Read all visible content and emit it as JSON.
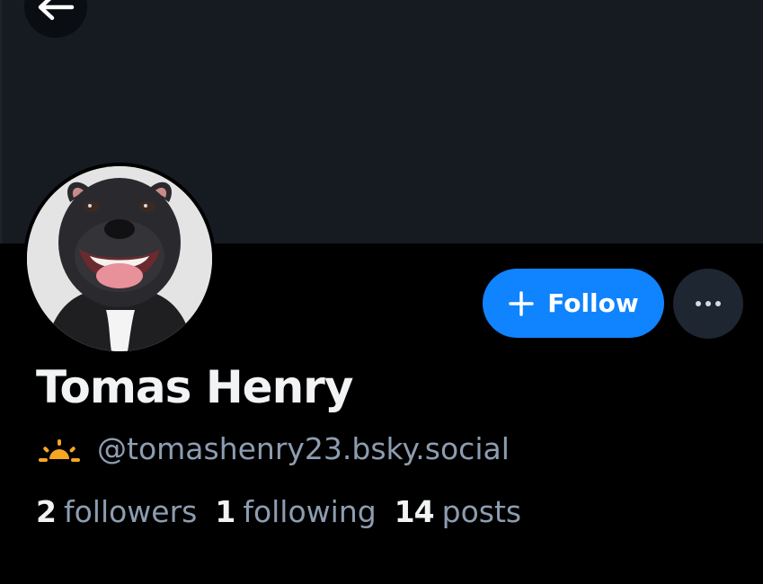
{
  "profile": {
    "display_name": "Tomas Henry",
    "handle": "@tomashenry23.bsky.social",
    "follow_label": "Follow",
    "avatar_icon": "dog-avatar",
    "handle_badge_icon": "sunrise-icon"
  },
  "stats": {
    "followers_count": "2",
    "followers_label": "followers",
    "following_count": "1",
    "following_label": "following",
    "posts_count": "14",
    "posts_label": "posts"
  },
  "colors": {
    "background": "#000000",
    "banner": "#161b22",
    "accent": "#1083fe",
    "muted_text": "#8d9db1",
    "primary_text": "#f1f3f5",
    "badge": "#f5a623"
  }
}
